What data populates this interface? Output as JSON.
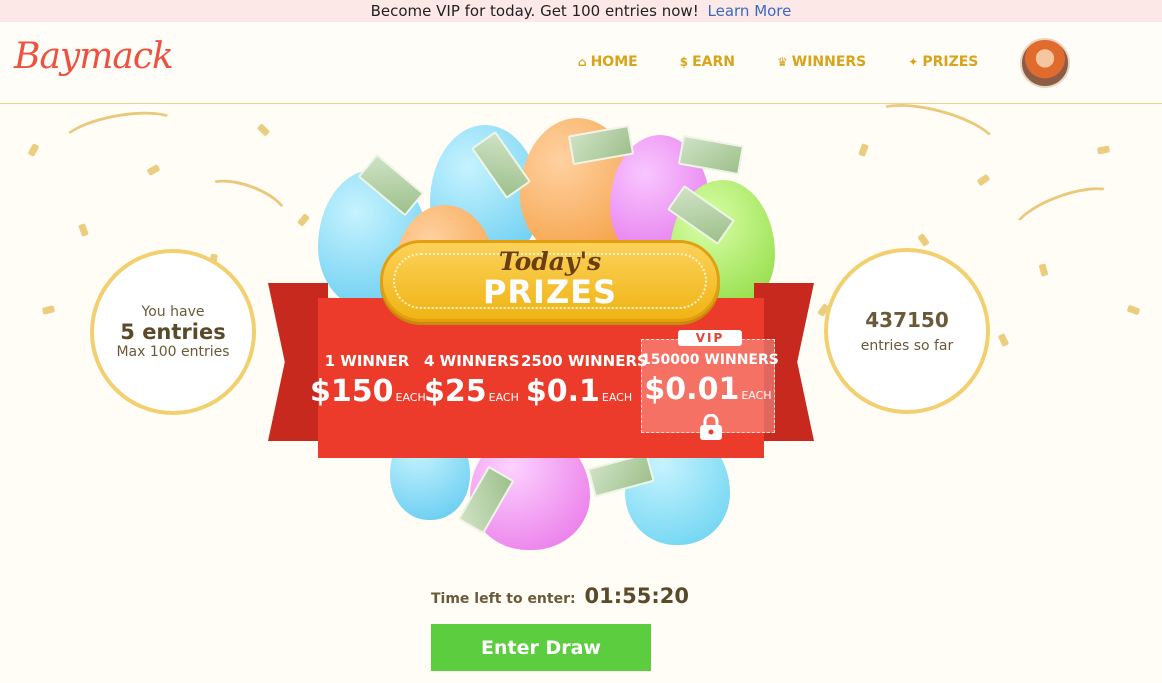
{
  "banner": {
    "text": "Become VIP for today. Get 100 entries now!",
    "link": "Learn More"
  },
  "header": {
    "logo": "Baymack",
    "nav": [
      {
        "icon": "home-icon",
        "glyph": "⌂",
        "label": "HOME"
      },
      {
        "icon": "dollar-icon",
        "glyph": "$",
        "label": "EARN"
      },
      {
        "icon": "trophy-icon",
        "glyph": "♛",
        "label": "WINNERS"
      },
      {
        "icon": "gift-icon",
        "glyph": "✦",
        "label": "PRIZES"
      }
    ]
  },
  "entries": {
    "line1": "You have",
    "count": "5 entries",
    "max": "Max 100 entries"
  },
  "totals": {
    "count": "437150",
    "label": "entries so far"
  },
  "prizes": {
    "title_small": "Today's",
    "title_big": "PRIZES",
    "each_label": "EACH",
    "vip_label": "VIP",
    "tiers": [
      {
        "winners": "1 WINNER",
        "amount": "$150"
      },
      {
        "winners": "4 WINNERS",
        "amount": "$25"
      },
      {
        "winners": "2500 WINNERS",
        "amount": "$0.1"
      },
      {
        "winners": "150000 WINNERS",
        "amount": "$0.01"
      }
    ]
  },
  "timer": {
    "label": "Time left to enter:",
    "value": "01:55:20"
  },
  "cta": {
    "label": "Enter Draw"
  },
  "colors": {
    "accent": "#ec3b2a",
    "gold": "#f0b414",
    "green": "#5ccd3f",
    "logo": "#ee5140"
  }
}
